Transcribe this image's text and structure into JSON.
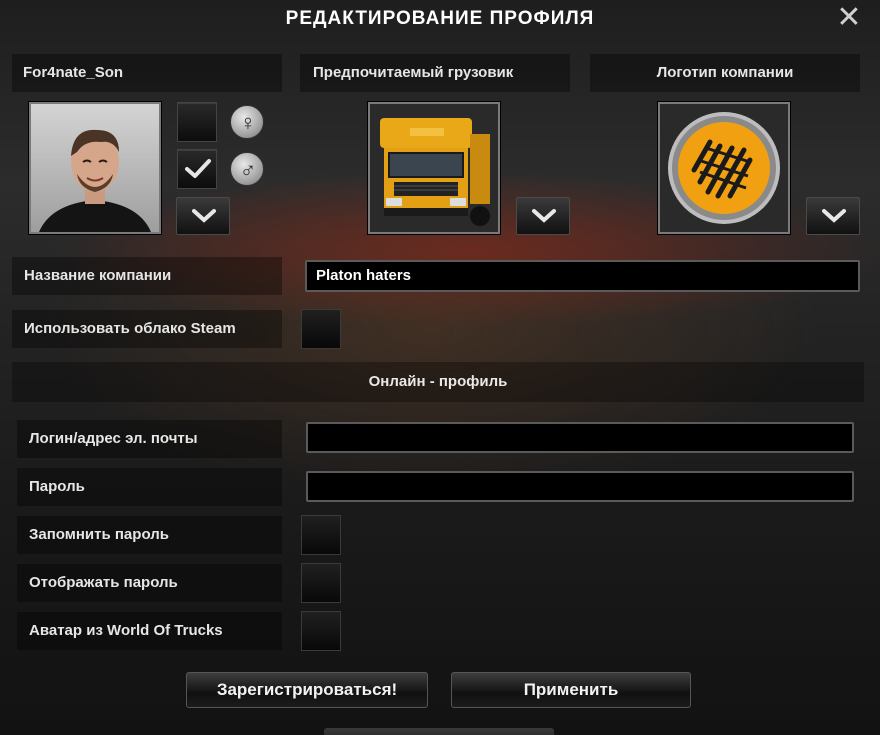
{
  "dialog": {
    "title": "РЕДАКТИРОВАНИЕ ПРОФИЛЯ"
  },
  "profile": {
    "name": "For4nate_Son",
    "gender_female_symbol": "♀",
    "gender_male_symbol": "♂",
    "gender_selected": "male"
  },
  "truck": {
    "header": "Предпочитаемый грузовик"
  },
  "logo": {
    "header": "Логотип компании"
  },
  "company": {
    "label": "Название компании",
    "value": "Platon haters"
  },
  "steam": {
    "label": "Использовать облако Steam",
    "checked": false
  },
  "online": {
    "header": "Онлайн - профиль",
    "login_label": "Логин/адрес эл. почты",
    "login_value": "",
    "password_label": "Пароль",
    "password_value": "",
    "remember_label": "Запомнить пароль",
    "show_label": "Отображать пароль",
    "avatar_label": "Аватар из World Of Trucks"
  },
  "buttons": {
    "register": "Зарегистрироваться!",
    "apply": "Применить"
  },
  "icons": {
    "close": "close-icon",
    "dropdown": "chevron-down-icon",
    "check": "checkmark-icon",
    "female": "female-symbol-icon",
    "male": "male-symbol-icon"
  },
  "colors": {
    "accent_truck": "#e8a818",
    "logo_orange": "#f0a010",
    "field_bg": "#000000"
  }
}
